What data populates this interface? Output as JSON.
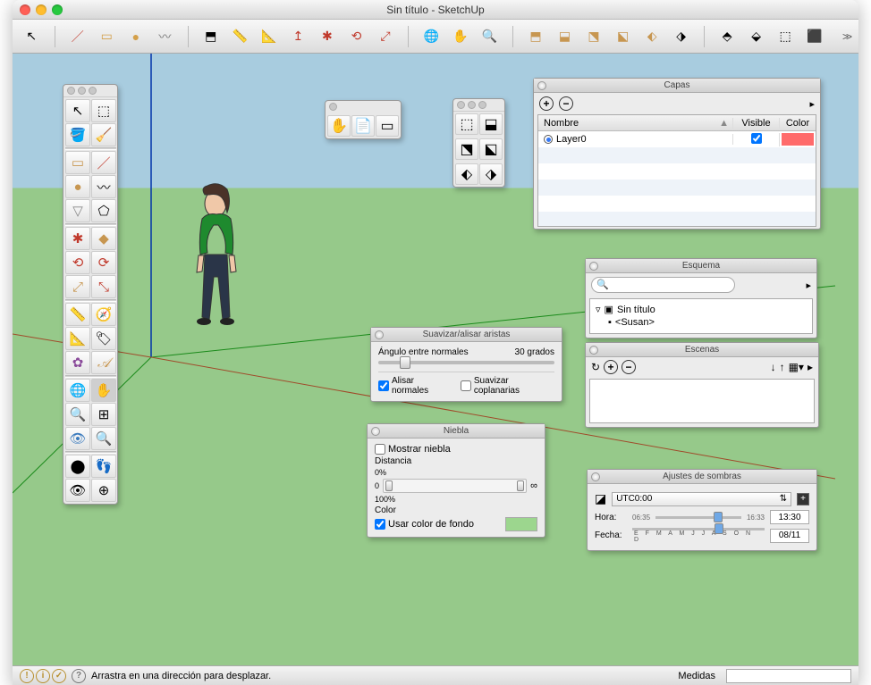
{
  "window": {
    "title": "Sin título - SketchUp"
  },
  "toolbar": {
    "icons": [
      "↖",
      "/",
      "▭",
      "●",
      "〰",
      "▫",
      "📏",
      "📐",
      "↥",
      "✱",
      "⟲",
      "⤢",
      "🌐",
      "✋",
      "🔍",
      "⬒",
      "⬓",
      "⬔",
      "⬕",
      "⬖",
      "⬗",
      "⬘",
      "⬙",
      "⬚",
      "⬛",
      "⬜",
      "◧",
      "◨"
    ]
  },
  "palette_icons": [
    "↖",
    "⬚",
    "✏",
    "🧹",
    "▭",
    "/",
    "●",
    "〰",
    "▽",
    "⬠",
    "✱",
    "◆",
    "⟲",
    "⟳",
    "⤢",
    "⤡",
    "📏",
    "🧭",
    "📐",
    "🏷",
    "✿",
    "𝒜",
    "🌐",
    "✋",
    "🔍",
    "⊞",
    "👁",
    "🔍",
    "⬤",
    "👣",
    "👁",
    "⊕"
  ],
  "mini1_icons": [
    "✋",
    "📄",
    "▭"
  ],
  "mini2_icons": [
    "⬚",
    "⬓",
    "⬔",
    "⬕",
    "⬖",
    "⬗"
  ],
  "panels": {
    "capas": {
      "title": "Capas",
      "col_name": "Nombre",
      "col_visible": "Visible",
      "col_color": "Color",
      "layer0": "Layer0"
    },
    "esquema": {
      "title": "Esquema",
      "root": "Sin título",
      "child": "<Susan>"
    },
    "escenas": {
      "title": "Escenas"
    },
    "suavizar": {
      "title": "Suavizar/alisar aristas",
      "angle_label": "Ángulo entre normales",
      "angle_value": "30",
      "angle_unit": "grados",
      "chk_alisar": "Alisar normales",
      "chk_suavizar": "Suavizar coplanarias"
    },
    "niebla": {
      "title": "Niebla",
      "chk_show": "Mostrar niebla",
      "dist_label": "Distancia",
      "pct0": "0%",
      "pct100": "100%",
      "color_label": "Color",
      "chk_bg": "Usar color de fondo"
    },
    "sombras": {
      "title": "Ajustes de sombras",
      "tz": "UTC0:00",
      "hora_label": "Hora:",
      "hora_min": "06:35",
      "hora_max": "16:33",
      "hora_val": "13:30",
      "fecha_label": "Fecha:",
      "fecha_val": "08/11",
      "months": "E F M A M J J A S O N D"
    }
  },
  "statusbar": {
    "hint": "Arrastra en una dirección para desplazar.",
    "medidas_label": "Medidas"
  }
}
